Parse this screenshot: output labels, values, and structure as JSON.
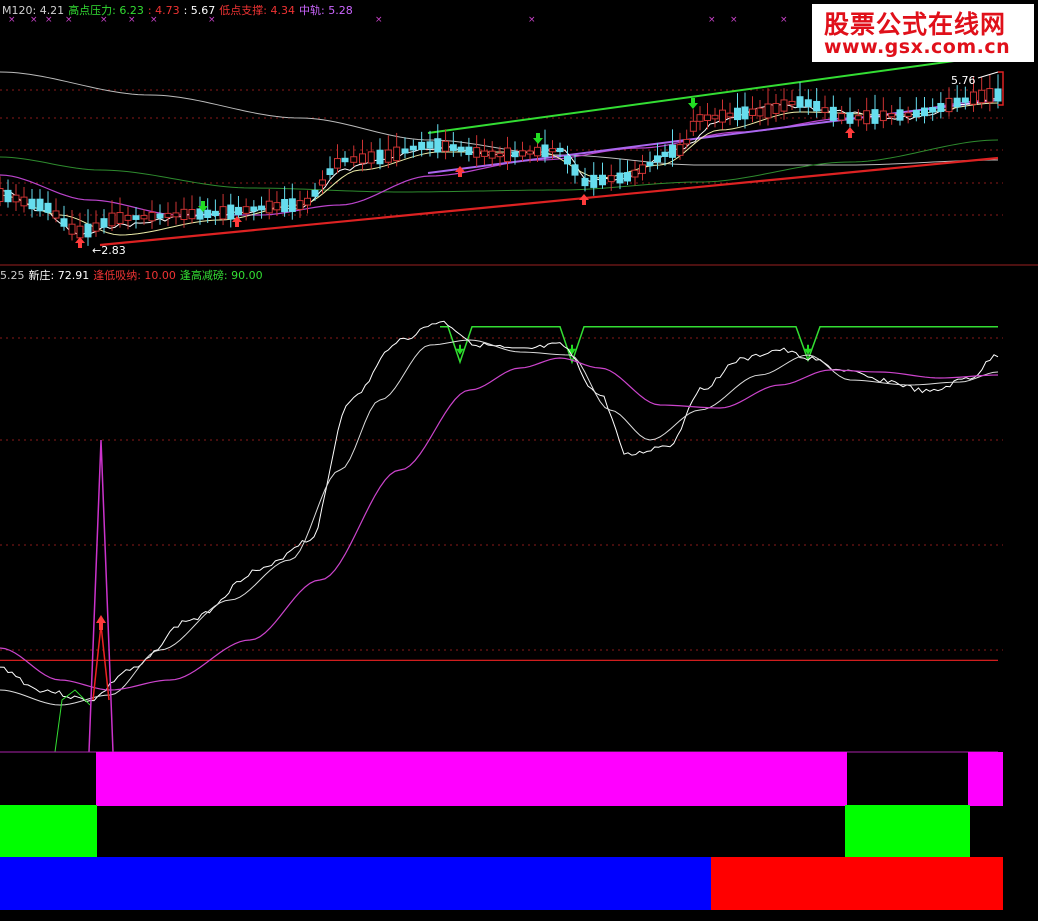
{
  "header": {
    "items": [
      {
        "label": "M120",
        "value": "4.21",
        "color": "#d0d0d0"
      },
      {
        "label": "高点压力",
        "value": "6.23",
        "color": "#33dd33"
      },
      {
        "label": "",
        "value": "4.73",
        "color": "#ee3333"
      },
      {
        "label": "",
        "value": "5.67",
        "color": "#ffffff"
      },
      {
        "label": "低点支撑",
        "value": "4.34",
        "color": "#ee3333"
      },
      {
        "label": "中轨",
        "value": "5.28",
        "color": "#cc66ff"
      }
    ]
  },
  "indicator_header": {
    "items": [
      {
        "label": "",
        "value": "5.25",
        "color": "#cccccc"
      },
      {
        "label": "新庄",
        "value": "72.91",
        "color": "#ffffff"
      },
      {
        "label": "逢低吸纳",
        "value": "10.00",
        "color": "#ee3333"
      },
      {
        "label": "逢高减磅",
        "value": "90.00",
        "color": "#33dd33"
      }
    ]
  },
  "watermark": {
    "line1": "股票公式在线网",
    "line2": "www.gsx.com.cn"
  },
  "chart_data": [
    {
      "type": "candlestick",
      "annotations": {
        "high_label": "5.76",
        "low_label": "2.83"
      },
      "arrows_up_x": [
        80,
        237,
        460,
        584,
        850
      ],
      "arrows_down_x": [
        203,
        538,
        693
      ]
    },
    {
      "type": "line",
      "ylim": [
        0,
        100
      ],
      "reference_lines": [
        {
          "name": "逢低吸纳",
          "value": 10,
          "color": "#ee2222"
        },
        {
          "name": "逢高减磅",
          "value": 90,
          "color": "#33dd33"
        }
      ],
      "signal_down_x": [
        460,
        572,
        808
      ],
      "spike_x": 101
    },
    {
      "type": "bands",
      "rows": [
        {
          "color": "#ff00ff",
          "segments": [
            [
              96,
              847
            ],
            [
              968,
              1003
            ]
          ]
        },
        {
          "color": "#00ff00",
          "segments": [
            [
              0,
              97
            ],
            [
              845,
              970
            ]
          ]
        },
        {
          "color": "#0000ff",
          "segments": [
            [
              0,
              711
            ]
          ]
        },
        {
          "color": "#ff0000",
          "segments": [
            [
              711,
              1003
            ]
          ]
        }
      ]
    }
  ],
  "colors": {
    "grid": "#8a1a1a",
    "divider": "#9a2020",
    "up_candle": "#cc3333",
    "down_candle": "#66ddee"
  }
}
